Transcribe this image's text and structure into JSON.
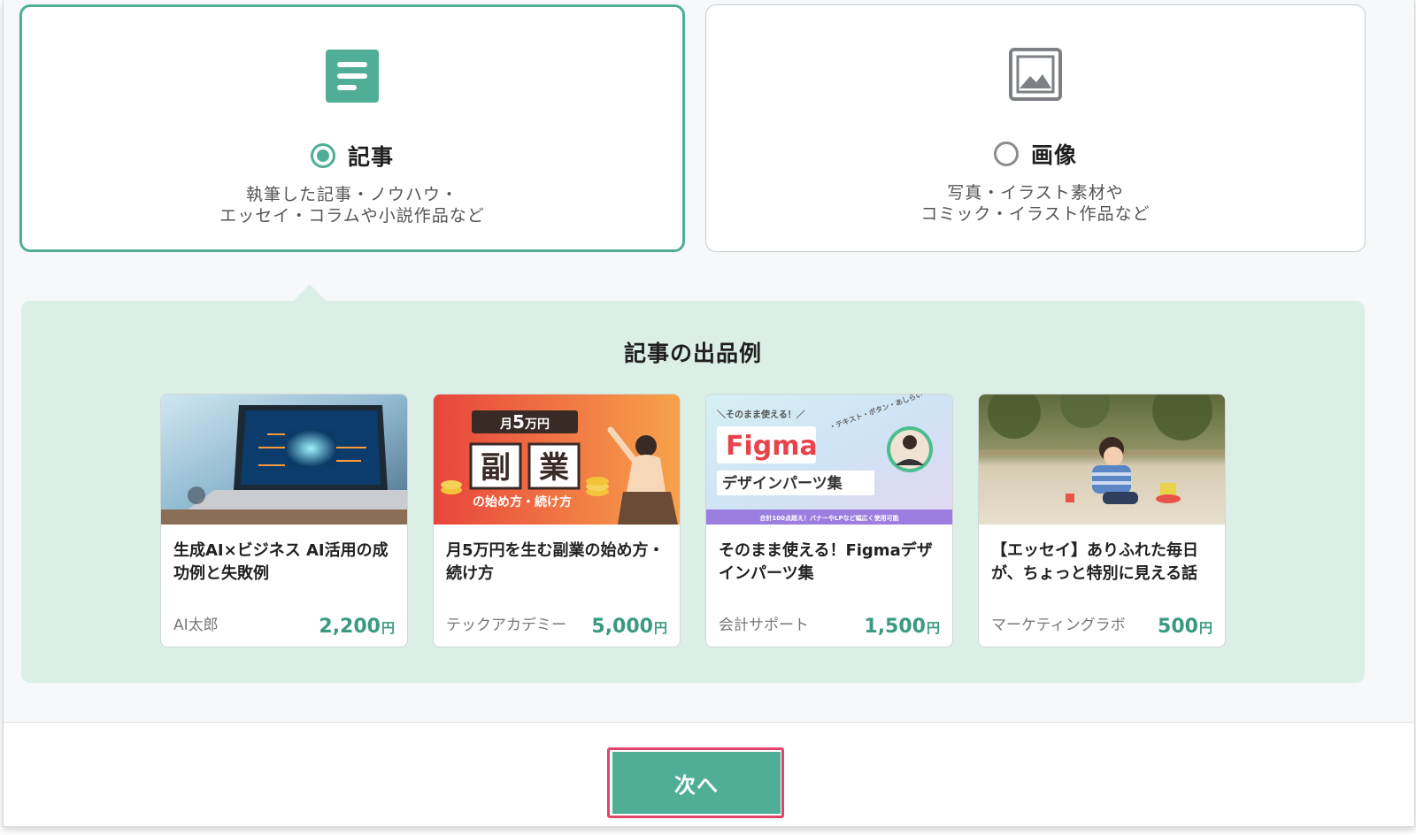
{
  "types": [
    {
      "label": "記事",
      "desc": [
        "執筆した記事・ノウハウ・",
        "エッセイ・コラムや小説作品など"
      ],
      "selected": true,
      "icon": "article-icon"
    },
    {
      "label": "画像",
      "desc": [
        "写真・イラスト素材や",
        "コミック・イラスト作品など"
      ],
      "selected": false,
      "icon": "image-icon"
    }
  ],
  "examples": {
    "title": "記事の出品例",
    "items": [
      {
        "title": "生成AI×ビジネス AI活用の成功例と失敗例",
        "seller": "AI太郎",
        "price": "2,200",
        "unit": "円"
      },
      {
        "title": "月5万円を生む副業の始め方・続け方",
        "seller": "テックアカデミー",
        "price": "5,000",
        "unit": "円",
        "thumb": {
          "badge_prefix": "月",
          "badge_amount": "5",
          "badge_suffix": "万円",
          "char1": "副",
          "char2": "業",
          "subtitle": "の始め方・続け方"
        }
      },
      {
        "title": "そのまま使える！Figmaデザインパーツ集",
        "seller": "会計サポート",
        "price": "1,500",
        "unit": "円",
        "thumb": {
          "top": "＼そのまま使える！／",
          "logo": "Figma",
          "sub": "デザインパーツ集",
          "side": "・テキスト・ボタン・あしらい",
          "bottom": "合計100点超え！バナーやLPなど幅広く使用可能"
        }
      },
      {
        "title": "【エッセイ】ありふれた毎日が、ちょっと特別に見える話",
        "seller": "マーケティングラボ",
        "price": "500",
        "unit": "円"
      }
    ]
  },
  "footer": {
    "next_label": "次へ"
  },
  "colors": {
    "accent": "#4fae95",
    "example_bg": "#dcefe7",
    "price": "#3a9a80",
    "highlight": "#e2456a"
  }
}
